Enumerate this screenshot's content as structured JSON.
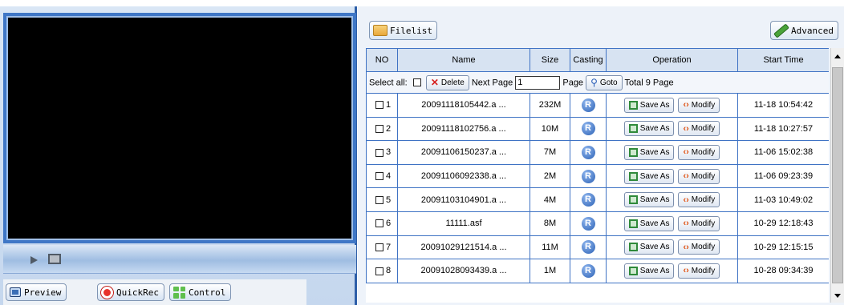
{
  "player": {
    "preview_label": "Preview",
    "quickrec_label": "QuickRec",
    "control_label": "Control"
  },
  "toolbar": {
    "filelist_label": "Filelist",
    "advanced_label": "Advanced"
  },
  "table": {
    "headers": [
      "NO",
      "Name",
      "Size",
      "Casting",
      "Operation",
      "Start Time"
    ],
    "select_all_label": "Select all:",
    "delete_label": "Delete",
    "next_page_label": "Next Page",
    "page_input_value": "1",
    "page_label": "Page",
    "goto_label": "Goto",
    "total_label": "Total 9  Page",
    "save_as_label": "Save As",
    "modify_label": "Modify",
    "rows": [
      {
        "no": "1",
        "name": "20091118105442.a ...",
        "size": "232M",
        "start": "11-18 10:54:42"
      },
      {
        "no": "2",
        "name": "20091118102756.a ...",
        "size": "10M",
        "start": "11-18 10:27:57"
      },
      {
        "no": "3",
        "name": "20091106150237.a ...",
        "size": "7M",
        "start": "11-06 15:02:38"
      },
      {
        "no": "4",
        "name": "20091106092338.a ...",
        "size": "2M",
        "start": "11-06 09:23:39"
      },
      {
        "no": "5",
        "name": "20091103104901.a ...",
        "size": "4M",
        "start": "11-03 10:49:02"
      },
      {
        "no": "6",
        "name": "11111.asf",
        "size": "8M",
        "start": "10-29 12:18:43"
      },
      {
        "no": "7",
        "name": "20091029121514.a ...",
        "size": "11M",
        "start": "10-29 12:15:15"
      },
      {
        "no": "8",
        "name": "20091028093439.a ...",
        "size": "1M",
        "start": "10-28 09:34:39"
      }
    ]
  },
  "icons": {
    "casting": "casting-disc-icon",
    "save": "floppy-disk-icon",
    "modify": "code-brackets-icon"
  },
  "colors": {
    "frame_border": "#3f77c6",
    "grid_border": "#3f73c4",
    "header_bg": "#d7e3f2"
  }
}
